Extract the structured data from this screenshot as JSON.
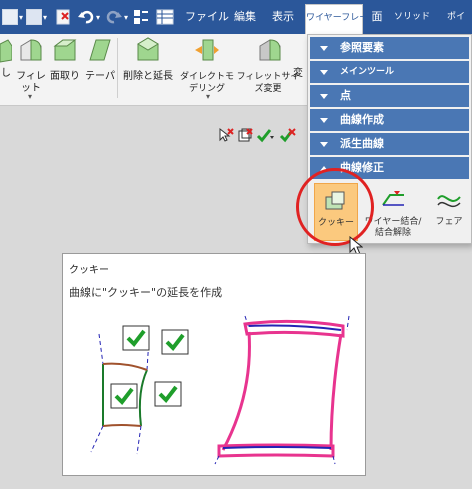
{
  "menu": {
    "tabs": [
      {
        "label": "ファイル"
      },
      {
        "label": "編集"
      },
      {
        "label": "表示"
      },
      {
        "label": "ワイヤーフレーム"
      },
      {
        "label": "面"
      },
      {
        "label": "ソリッド"
      },
      {
        "label": "ポイ"
      }
    ],
    "active_tab": "ワイヤーフレーム"
  },
  "ribbon": {
    "partial_label": "し",
    "buttons": [
      {
        "label": "フィレット"
      },
      {
        "label": "面取り"
      },
      {
        "label": "テーパ"
      },
      {
        "label": "削除と延長"
      },
      {
        "label": "ダイレクトモデリング"
      },
      {
        "label": "フィレットサイズ変更"
      },
      {
        "label": "変"
      }
    ]
  },
  "dropdown": {
    "categories": [
      {
        "label": "参照要素"
      },
      {
        "label": "メインツール"
      },
      {
        "label": "点"
      },
      {
        "label": "曲線作成"
      },
      {
        "label": "派生曲線"
      },
      {
        "label": "曲線修正"
      }
    ],
    "tools": [
      {
        "label": "クッキー",
        "selected": true
      },
      {
        "label": "ワイヤー結合/結合解除",
        "selected": false
      },
      {
        "label": "フェア",
        "selected": false
      }
    ]
  },
  "tooltip": {
    "title": "クッキー",
    "description": "曲線に\"クッキー\"の延長を作成"
  },
  "colors": {
    "title_bar": "#2b579a",
    "category_header": "#4a77b4",
    "selected_tool": "#fbc97e",
    "highlight_circle": "#e02222",
    "cookie_curve": "#e8348f",
    "base_curve": "#2323b4",
    "check_green": "#1f9e2b",
    "edge_brown": "#a0522d"
  },
  "icons": {
    "quick_access": [
      "new-icon",
      "save-icon",
      "delete-icon",
      "undo-icon",
      "redo-icon",
      "properties-icon",
      "table-icon"
    ],
    "mini_toolbar": [
      "select-cross-icon",
      "box-select-icon",
      "check-filter-icon",
      "check-red-icon"
    ]
  }
}
